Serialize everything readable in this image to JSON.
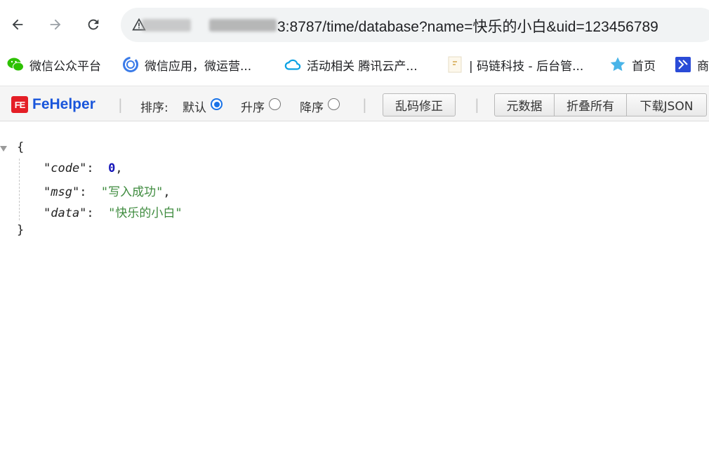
{
  "browser": {
    "url_visible": "3:8787/time/database?name=快乐的小白&uid=123456789"
  },
  "bookmarks": [
    {
      "label": "微信公众平台",
      "icon": "wechat-icon"
    },
    {
      "label": "微信应用，微运营...",
      "icon": "ring-icon"
    },
    {
      "label": "活动相关 腾讯云产...",
      "icon": "cloud-icon"
    },
    {
      "label": "| 码链科技 - 后台管...",
      "icon": "page-icon"
    },
    {
      "label": "首页",
      "icon": "star-icon"
    },
    {
      "label": "商",
      "icon": "shop-icon"
    }
  ],
  "fehelper": {
    "name": "FeHelper",
    "badge": "FE",
    "sort_label": "排序:",
    "sort_options": [
      {
        "label": "默认",
        "checked": true
      },
      {
        "label": "升序",
        "checked": false
      },
      {
        "label": "降序",
        "checked": false
      }
    ],
    "fix_button": "乱码修正",
    "group_buttons": [
      "元数据",
      "折叠所有",
      "下载JSON"
    ]
  },
  "json": {
    "open_brace": "{",
    "close_brace": "}",
    "entries": [
      {
        "key": "\"code\"",
        "value": "0",
        "type": "number",
        "comma": true
      },
      {
        "key": "\"msg\"",
        "value": "\"写入成功\"",
        "type": "string",
        "comma": true
      },
      {
        "key": "\"data\"",
        "value": "\"快乐的小白\"",
        "type": "string",
        "comma": false
      }
    ]
  },
  "colors": {
    "accent": "#1a73e8",
    "fehelper_brand": "#1a56db",
    "fehelper_badge": "#e41e26",
    "json_number": "#1414b8",
    "json_string": "#3e8b3e"
  }
}
